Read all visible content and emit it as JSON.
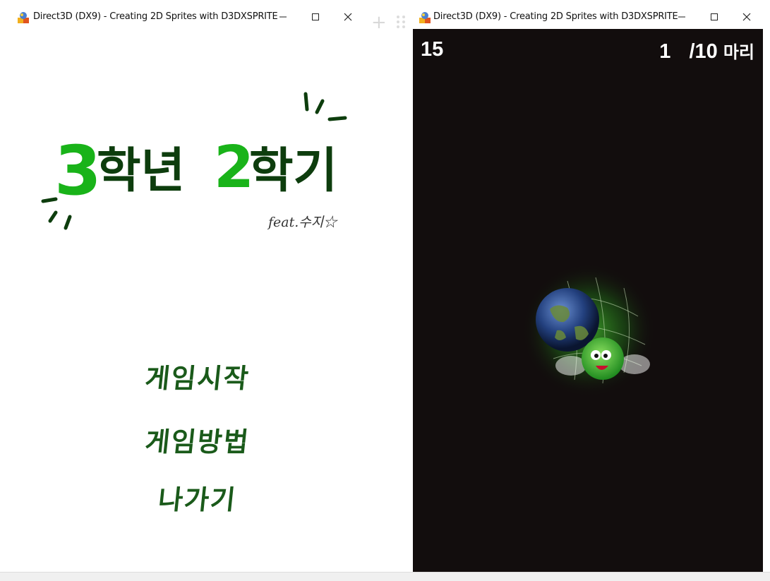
{
  "left_window": {
    "title": "Direct3D (DX9) - Creating 2D Sprites with D3DXSPRITE",
    "icon": "directx-app-icon",
    "controls": [
      "minimize",
      "maximize",
      "close"
    ],
    "game_title": {
      "part1_number": "3",
      "part1_text": "학년",
      "part2_number": "2",
      "part2_text": "학기"
    },
    "feat": "feat.수지☆",
    "menu": {
      "start": "게임시작",
      "howto": "게임방법",
      "exit": "나가기"
    }
  },
  "right_window": {
    "title": "Direct3D (DX9) - Creating 2D Sprites with D3DXSPRITE",
    "icon": "directx-app-icon",
    "controls": [
      "minimize",
      "maximize",
      "close"
    ],
    "hud": {
      "score": "15",
      "caught": "1",
      "total": "/10",
      "unit": "마리"
    },
    "background_color": "#120d0d"
  },
  "colors": {
    "title_green_bright": "#19b319",
    "title_green_dark": "#0d3d0d",
    "menu_green": "#1a5a1a"
  }
}
